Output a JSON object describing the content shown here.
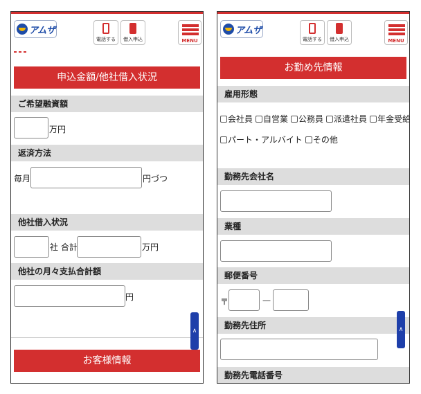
{
  "header": {
    "logo_text": "アムザ",
    "call_label": "電話する",
    "apply_label": "借入申込",
    "menu_label": "MENU",
    "accent_color": "#d32f2f",
    "logo_color": "#1e4ca8"
  },
  "left": {
    "section_title": "申込金額/他社借入状況",
    "desired_amount": {
      "label": "ご希望融資額",
      "unit": "万円",
      "value": ""
    },
    "repayment": {
      "label": "返済方法",
      "prefix": "毎月",
      "unit": "円づつ",
      "value": ""
    },
    "other_loans": {
      "label": "他社借入状況",
      "companies_unit": "社 合計",
      "amount_unit": "万円"
    },
    "monthly_payment": {
      "label": "他社の月々支払合計額",
      "unit": "円"
    },
    "next_section_title": "お客様情報",
    "scroll_top_label": "∧"
  },
  "right": {
    "section_title": "お勤め先情報",
    "employment": {
      "label": "雇用形態",
      "options": [
        "会社員",
        "自営業",
        "公務員",
        "派遣社員",
        "年金受給者",
        "パート・アルバイト",
        "その他"
      ]
    },
    "company_name": {
      "label": "勤務先会社名"
    },
    "industry": {
      "label": "業種"
    },
    "postal": {
      "label": "郵便番号",
      "prefix": "〒",
      "separator": "—"
    },
    "address": {
      "label": "勤務先住所"
    },
    "phone": {
      "label": "勤務先電話番号"
    },
    "scroll_top_label": "∧"
  }
}
